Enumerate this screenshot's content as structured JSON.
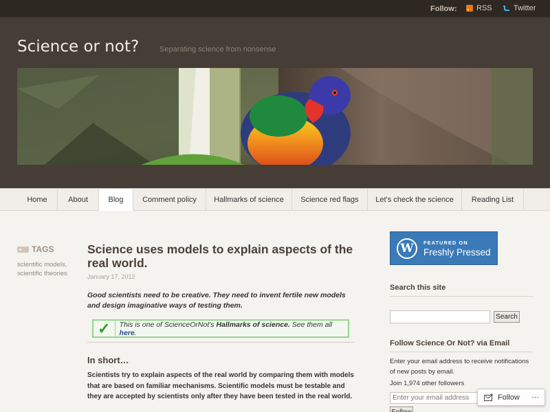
{
  "topbar": {
    "follow_label": "Follow:",
    "rss_label": "RSS",
    "twitter_label": "Twitter"
  },
  "site": {
    "title": "Science or not?",
    "tagline": "Separating science from nonsense"
  },
  "nav": [
    {
      "label": "Home"
    },
    {
      "label": "About"
    },
    {
      "label": "Blog",
      "active": true
    },
    {
      "label": "Comment policy"
    },
    {
      "label": "Hallmarks of science"
    },
    {
      "label": "Science red flags"
    },
    {
      "label": "Let's check the science"
    },
    {
      "label": "Reading List"
    }
  ],
  "tags": {
    "heading": "TAGS",
    "items": [
      "scientific models,",
      "scientific theories"
    ]
  },
  "post": {
    "title": "Science uses models to explain aspects of the real world.",
    "date": "January 17, 2012",
    "lead": "Good scientists need to be creative. They need to invent fertile new models and design imaginative ways of testing them.",
    "hallmark": {
      "prefix": "This is one of ScienceOrNot's ",
      "bold": "Hallmarks of science.",
      "middle": " See them all ",
      "link": "here",
      "suffix": "."
    },
    "in_short_heading": "In short…",
    "in_short_body": "Scientists try to explain aspects of the real world by comparing them with models that are based on familiar mechanisms. Scientific models must be testable and they are accepted by scientists only after they have been tested in the real world."
  },
  "sidebar": {
    "badge_small": "FEATURED ON",
    "badge_big": "Freshly Pressed",
    "search_heading": "Search this site",
    "search_button": "Search",
    "follow_heading": "Follow Science Or Not? via Email",
    "follow_text": "Enter your email address to receive notifications of new posts by email.",
    "followers_text": "Join 1,974 other followers",
    "email_placeholder": "Enter your email address",
    "follow_submit": "Follow"
  },
  "follow_bubble": {
    "label": "Follow",
    "more": "⋯"
  },
  "colors": {
    "header_bg": "#453d36",
    "topbar_bg": "#2e2823",
    "accent_green": "#94d68f",
    "badge_blue": "#3a7ab8"
  }
}
